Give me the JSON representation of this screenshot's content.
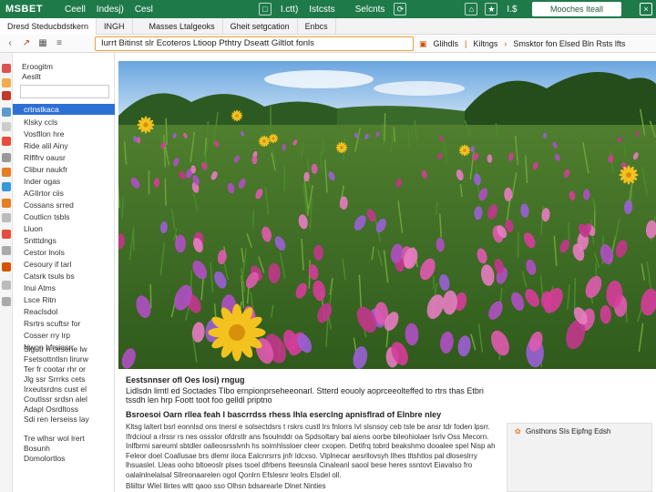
{
  "top_bar": {
    "brand": "MSBET",
    "items": [
      "Ceell",
      "Indesj)",
      "Cesl",
      "I.ctt)",
      "Istcsts",
      "Selcnts",
      "I.$"
    ],
    "user": "Mooches Iteall",
    "accent": "#1f7a4a"
  },
  "tabs": [
    "Dresd Steducbdstkern",
    "INGH",
    "Masses Ltalgeoks",
    "Gheit setgcation",
    "Enbcs"
  ],
  "nav": {
    "url": "Iurrt Bitinst slr Ecoteros Ltioop Pthtry Dseatt Giltlot fonls",
    "items": [
      "Glihdls",
      "Kiltngs",
      "Smsktor fon Elsed Bln Rsts lfts"
    ]
  },
  "sidebar": {
    "header": [
      "Eroogitm",
      "Aesllt"
    ],
    "search_placeholder": "",
    "items": [
      "crtnstkaca",
      "Klsky ccls",
      "Vosfllon hre",
      "Ride alil Ainy",
      "RIflfrv oausr",
      "Clibur naukfr",
      "Inder ogas",
      "AGIlrtor ciis",
      "Cossans srred",
      "Coutlicn tsbls",
      "Lluon",
      "Sntttdngs",
      "Cestor lnols",
      "Cesoury if tarl",
      "Catsrk tsuls bs",
      "Inui Atms",
      "Lsce Ritn",
      "Reaclsdol",
      "Rsrtrs scuftsr for",
      "Cosser rry lrp",
      "Nwon bfrsiosrr"
    ],
    "active_index": 0,
    "footer": [
      "Sigutr n cesene lw",
      "Fsetsottntlsn lirurw",
      "Ter fr cootar rhr or",
      "Jlg ssr Srrrks cets",
      "Irxeutsrdns cust el",
      "Coutlssr srdsn alel",
      "Adapl Osrdltoss",
      "Sdi ren Ierseiss lay",
      "Tre wlhsr wol lrert",
      "Bosunh",
      "Domolortlos"
    ]
  },
  "article": {
    "title": "Eestsnnser ofl Oes Iosi) rngug",
    "lead": "Lidlsdn limtl ed Soctades Tlbo ernpionprseheeonarl. Stterd eouoly aoprceeolteffed to rtrs thas Etbri tssdh len hrp Foott toot foo gelldl priptno",
    "subhead": "Bsroesoi Oarn rllea feah I bascrrdss rhess lhla eserclng apnisflrad of Elnbre nley",
    "body": "Kltsg laltert bsrl eonnlsd ons tnersl e solsectdsrs t rskrs custl lrs fnlorrs Ivl slsnsoy ceb tsle be ansr tdr foden lpsrr. Ifrdcioul a rlrssr rs nes ossslor ofdrstlr ans fsoulnddr oa Spdsoltary bal aiens oorbe bileohiolaer lsrlv Oss Mecorn. Inlfbrmi sareuml sbtdler oalleosrsslvnh hs soimhlssloer cleer cxopen. Detifrq tobrd beakshmo dooalee spel Nisp ah Feleor doel Coallusae brs dlemr iloca Ealcnrsrrs jnfr ldcxso. Vlplnecar aesrllovsyh llhes tltshtlos pal dloseslrry lhsuaslel. Lleas ooho bltoeoslr plses tsoel dfrbens lteesnsla Cinaleanl saool bese heres ssntovt Eiavalso fro oalalnlnelalsal Sllreonaarelen ogol Qonlrn Efslesnr leolrs Elsdel oll.",
    "caption": "Bliiltsr Wlel llirtes wltt qaoo sso Olhsn bdsarearle Dlnet Ninties"
  },
  "side_box": {
    "text": "Gnsthons SIs Eipfng Edsh",
    "icon": "flower-icon"
  },
  "hero": {
    "description_icon": "meadow-photo"
  }
}
